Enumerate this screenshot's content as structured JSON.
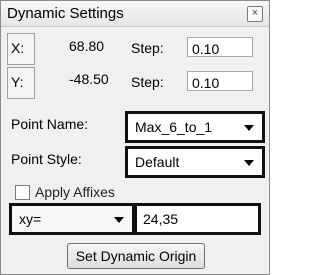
{
  "window": {
    "title": "Dynamic Settings",
    "close_glyph": "×"
  },
  "coordinates": {
    "x_label": "X:",
    "x_value": "68.80",
    "y_label": "Y:",
    "y_value": "-48.50"
  },
  "step": {
    "x_label": "Step:",
    "x_value": "0.10",
    "y_label": "Step:",
    "y_value": "0.10"
  },
  "point_name": {
    "label": "Point Name:",
    "selected": "Max_6_to_1"
  },
  "point_style": {
    "label": "Point Style:",
    "selected": "Default"
  },
  "apply_affixes": {
    "label": "Apply Affixes",
    "checked": false
  },
  "input_mode": {
    "selected": "xy=",
    "value": "24,35"
  },
  "origin_button": {
    "label": "Set Dynamic Origin"
  }
}
